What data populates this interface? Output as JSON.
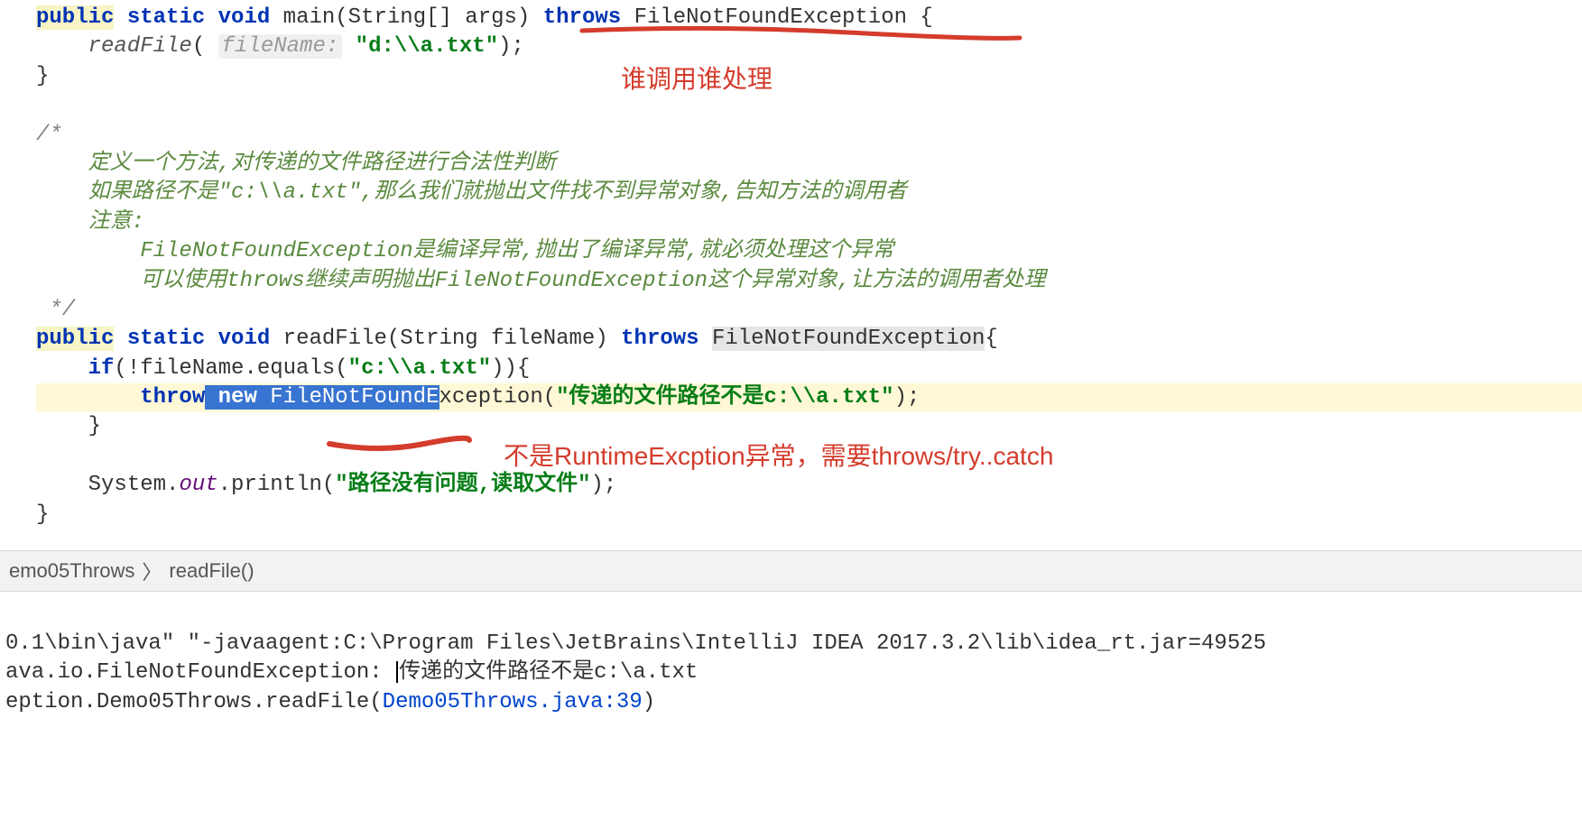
{
  "code": {
    "main_sig_1": "public",
    "main_sig_2": "static",
    "main_sig_3": "void",
    "main_name": "main",
    "main_params": "(String[] args)",
    "throws_kw": "throws",
    "main_throws": "FileNotFoundException",
    "readfile_call": "readFile",
    "hint_filename": "fileName:",
    "arg_path": "\"d:\\\\a.txt\"",
    "cmt_open": "/*",
    "cmt_l1": "定义一个方法,对传递的文件路径进行合法性判断",
    "cmt_l2a": "如果路径不是",
    "cmt_l2b": "\"c:\\\\a.txt\"",
    "cmt_l2c": ",那么我们就抛出文件找不到异常对象,告知方法的调用者",
    "cmt_l3": "注意:",
    "cmt_l4": "FileNotFoundException是编译异常,抛出了编译异常,就必须处理这个异常",
    "cmt_l5": "可以使用throws继续声明抛出FileNotFoundException这个异常对象,让方法的调用者处理",
    "cmt_close": " */",
    "readfile_sig_name": "readFile",
    "readfile_params": "(String fileName)",
    "readfile_throws": "FileNotFoundException",
    "if_kw": "if",
    "if_cond_a": "(!fileName.equals(",
    "if_cond_str": "\"c:\\\\a.txt\"",
    "if_cond_b": ")){",
    "throw_kw": "throw",
    "new_kw": "new",
    "ex_name_sel": "FileNotFoundE",
    "ex_name_rest": "xception",
    "throw_msg": "\"传递的文件路径不是c:\\\\a.txt\"",
    "sys": "System",
    "out": "out",
    "println": ".println(",
    "println_msg": "\"路径没有问题,读取文件\"",
    "semi": ";",
    "paren_close": ")",
    "brace_open": "{",
    "brace_close": "}"
  },
  "annotations": {
    "a1": "谁调用谁处理",
    "a2": "不是RuntimeExcption异常，需要throws/try..catch"
  },
  "breadcrumb": {
    "class": "emo05Throws",
    "sep": "〉",
    "method": "readFile()"
  },
  "console": {
    "l1": "0.1\\bin\\java\" \"-javaagent:C:\\Program Files\\JetBrains\\IntelliJ IDEA 2017.3.2\\lib\\idea_rt.jar=49525",
    "l2a": "ava.io.FileNotFoundException: ",
    "l2b": "传递的文件路径不是c:\\a.txt",
    "l3a": "eption.Demo05Throws.readFile(",
    "l3b": "Demo05Throws.java:39",
    "l3c": ")"
  }
}
